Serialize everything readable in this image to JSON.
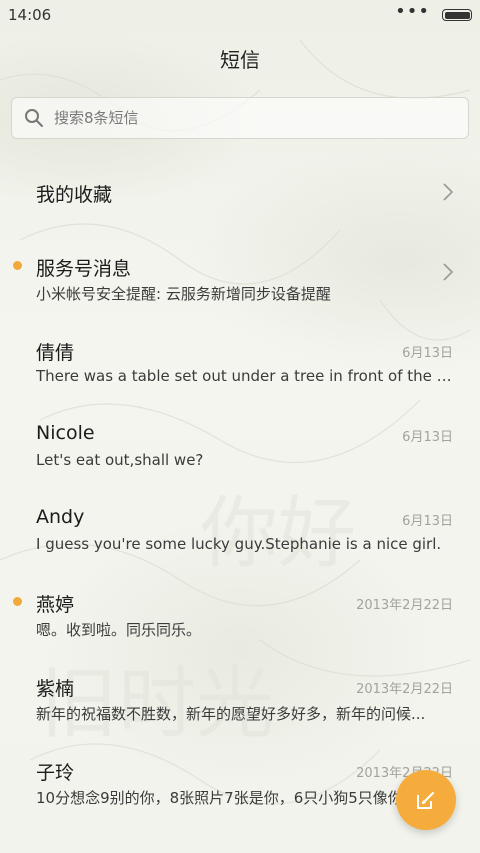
{
  "status_bar": {
    "time": "14:06",
    "more_icon": "more-dots-icon",
    "battery_icon": "battery-icon",
    "battery_level": 1.0
  },
  "header": {
    "title": "短信"
  },
  "search": {
    "placeholder": "搜索8条短信",
    "value": "",
    "icon": "search-icon"
  },
  "favorites": {
    "label": "我的收藏",
    "icon": "chevron-right-icon"
  },
  "conversations": [
    {
      "name": "服务号消息",
      "preview": "小米帐号安全提醒: 云服务新增同步设备提醒",
      "date": "",
      "unread": true,
      "has_chevron": true
    },
    {
      "name": "倩倩",
      "preview": "There was a table set out under a tree in front of the ho...",
      "date": "6月13日",
      "unread": false,
      "has_chevron": false
    },
    {
      "name": "Nicole",
      "preview": "Let's eat out,shall we?",
      "date": "6月13日",
      "unread": false,
      "has_chevron": false
    },
    {
      "name": "Andy",
      "preview": "I guess you're some lucky guy.Stephanie is a nice girl.",
      "date": "6月13日",
      "unread": false,
      "has_chevron": false
    },
    {
      "name": "燕婷",
      "preview": "嗯。收到啦。同乐同乐。",
      "date": "2013年2月22日",
      "unread": true,
      "has_chevron": false
    },
    {
      "name": "紫楠",
      "preview": "新年的祝福数不胜数，新年的愿望好多好多，新年的问候...",
      "date": "2013年2月22日",
      "unread": false,
      "has_chevron": false
    },
    {
      "name": "子玲",
      "preview": "10分想念9别的你，8张照片7张是你，6只小狗5只像你...",
      "date": "2013年2月22日",
      "unread": false,
      "has_chevron": false
    }
  ],
  "compose_button": {
    "icon": "compose-icon"
  },
  "colors": {
    "accent": "#f6ac3d",
    "unread_dot": "#f2a83a",
    "date_text": "#a3a39c",
    "background": "#f3f4ee"
  }
}
